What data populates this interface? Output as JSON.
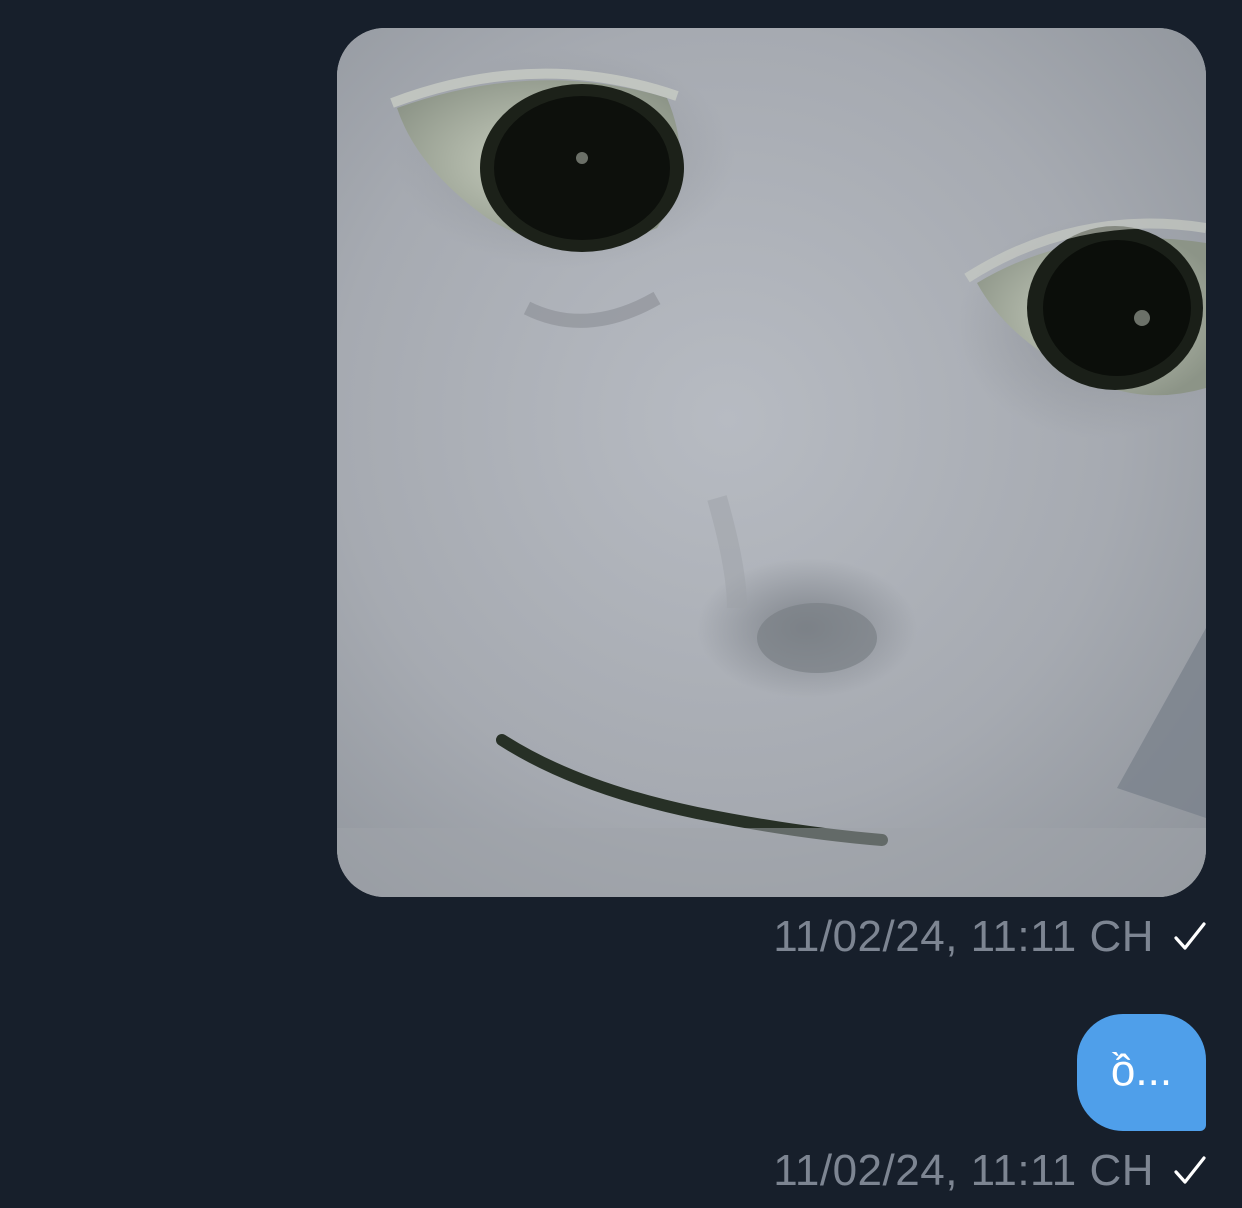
{
  "messages": [
    {
      "type": "image",
      "image_description_icon": "photo-face-meme",
      "timestamp": "11/02/24, 11:11 CH",
      "status_icon": "checkmark-icon"
    },
    {
      "type": "text",
      "text": "ồ...",
      "timestamp": "11/02/24, 11:11 CH",
      "status_icon": "checkmark-icon"
    }
  ],
  "colors": {
    "background": "#171f2b",
    "outgoing_bubble": "#4f9fea",
    "timestamp": "#7d8592",
    "check": "#ffffff"
  }
}
